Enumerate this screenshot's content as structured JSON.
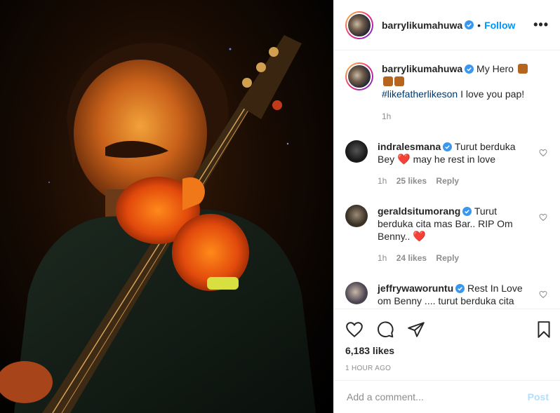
{
  "post": {
    "username": "barrylikumahuwa",
    "follow_label": "Follow",
    "dot": "•",
    "more_label": "•••"
  },
  "caption": {
    "username": "barrylikumahuwa",
    "text_a": "My Hero",
    "hashtag": "#likefatherlikeson",
    "text_b": "I love you pap!",
    "time": "1h"
  },
  "comments": [
    {
      "username": "indralesmana",
      "text_a": "Turut berduka Bey",
      "heart": "❤️",
      "text_b": "may he rest in love",
      "time": "1h",
      "likes": "25 likes",
      "reply": "Reply"
    },
    {
      "username": "geraldsitumorang",
      "text_a": "Turut berduka cita mas Bar.. RIP Om Benny..",
      "heart": "❤️",
      "time": "1h",
      "likes": "24 likes",
      "reply": "Reply"
    },
    {
      "username": "jeffrywaworuntu",
      "text_a": "Rest In Love om Benny .... turut berduka cita"
    }
  ],
  "stats": {
    "likes": "6,183 likes",
    "timestamp": "1 HOUR AGO"
  },
  "add_comment": {
    "placeholder": "Add a comment...",
    "post_label": "Post"
  },
  "icons": {
    "like": "heart-icon",
    "comment": "comment-icon",
    "share": "paper-plane-icon",
    "save": "bookmark-icon",
    "verified": "verified-badge-icon"
  },
  "colors": {
    "link_blue": "#0095f6",
    "hashtag": "#00376b",
    "muted": "#8e8e8e",
    "post_disabled": "#b2dffc"
  }
}
